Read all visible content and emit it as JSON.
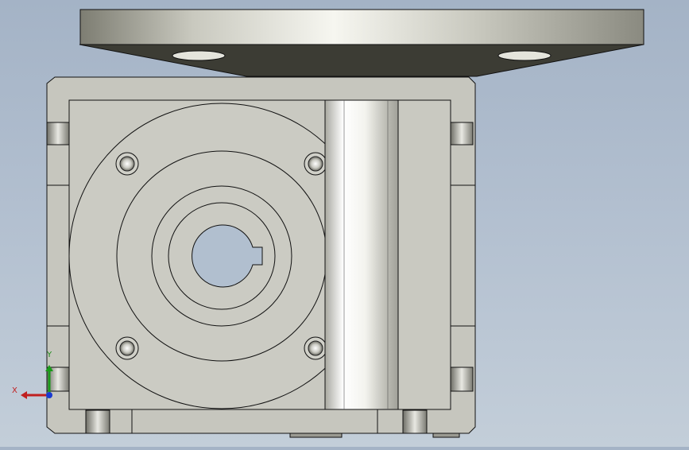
{
  "viewport": {
    "background_top": "#a4b3c6",
    "background_bottom": "#c3ced9"
  },
  "model": {
    "body_color": "#c4c4bc",
    "face_color": "#cfcfc7",
    "flange_color": "#b5b5ac",
    "edge_color": "#1a1a1a"
  },
  "triad": {
    "x_label": "X",
    "y_label": "Y",
    "x_color": "#c02020",
    "y_color": "#1a9a1a",
    "z_color": "#1a3ad0"
  }
}
